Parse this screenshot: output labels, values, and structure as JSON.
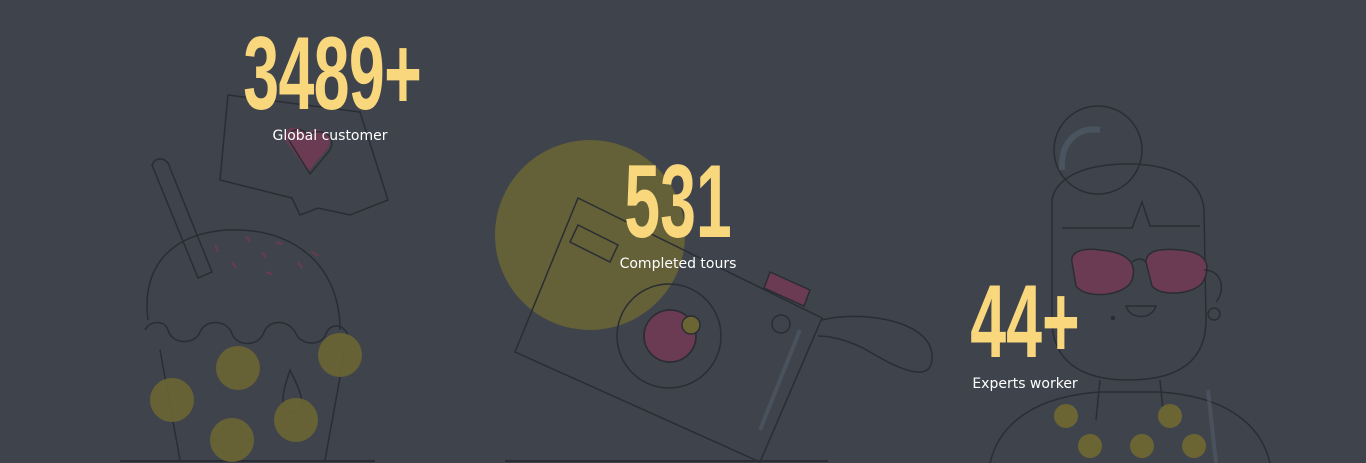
{
  "stats": [
    {
      "value": "3489+",
      "label": "Global customer"
    },
    {
      "value": "531",
      "label": "Completed tours"
    },
    {
      "value": "44+",
      "label": "Experts worker"
    }
  ],
  "colors": {
    "background": "#3f434c",
    "number": "#f9d77c",
    "label": "#ffffff",
    "line": "#2a2d33",
    "accent_yellow": "#6b6534",
    "accent_pink": "#6a3b52",
    "accent_blue": "#4e5b68"
  },
  "illustrations": [
    "ice-cream-illustration",
    "heart-message-illustration",
    "camera-illustration",
    "woman-sunglasses-illustration"
  ]
}
